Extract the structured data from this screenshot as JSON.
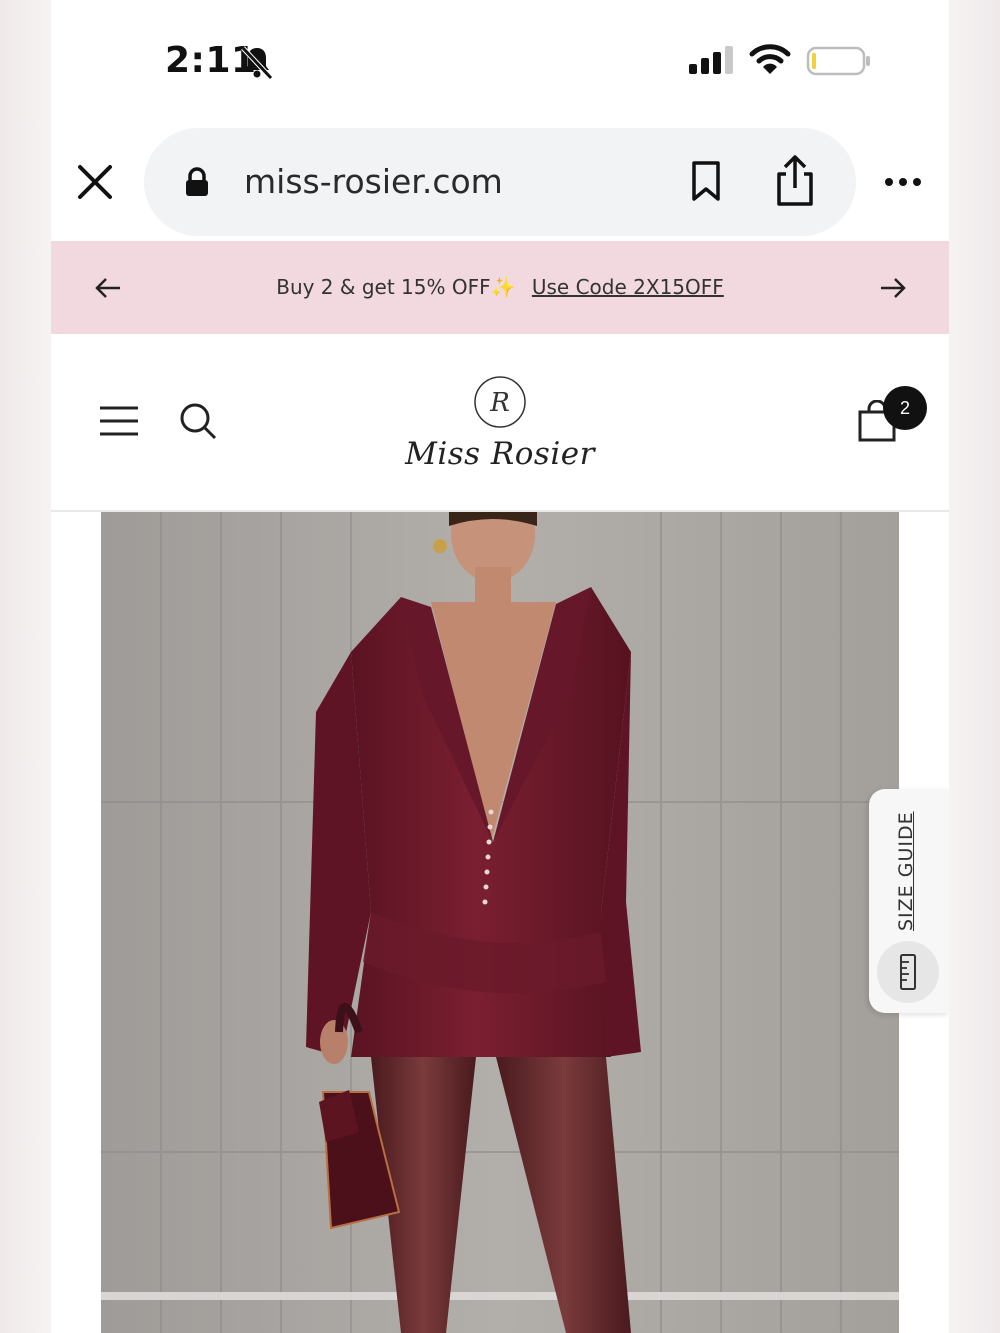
{
  "status_bar": {
    "time": "2:11"
  },
  "browser": {
    "url": "miss-rosier.com"
  },
  "promo": {
    "text": "Buy 2 & get 15% OFF",
    "sparkle": "✨",
    "code_text": "Use Code 2X15OFF"
  },
  "header": {
    "brand": "Miss Rosier",
    "logo_monogram": "R",
    "cart_count": "2"
  },
  "size_guide": {
    "label": "SIZE GUIDE"
  },
  "colors": {
    "promo_bg": "#f2d9df",
    "dress": "#6e1a2c",
    "badge": "#111111"
  },
  "icons": [
    "bell-slash-icon",
    "signal-icon",
    "wifi-icon",
    "battery-icon",
    "close-icon",
    "lock-icon",
    "bookmark-icon",
    "share-icon",
    "more-icon",
    "arrow-left-icon",
    "arrow-right-icon",
    "menu-icon",
    "search-icon",
    "cart-icon",
    "ruler-icon"
  ]
}
